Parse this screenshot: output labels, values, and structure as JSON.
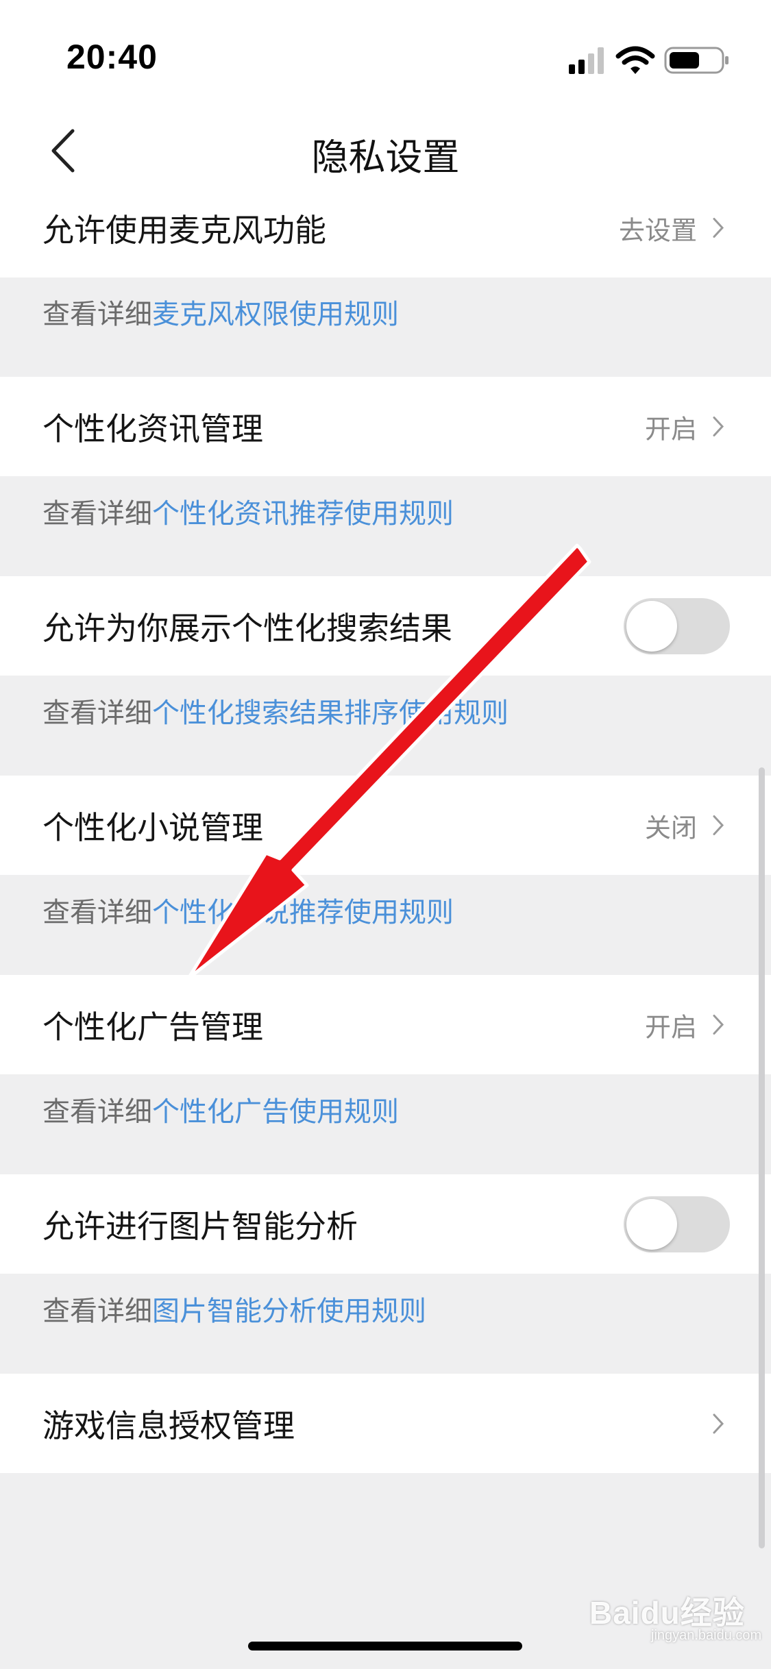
{
  "status_bar": {
    "time": "20:40"
  },
  "nav": {
    "title": "隐私设置"
  },
  "settings": [
    {
      "label": "允许使用麦克风功能",
      "value": "去设置",
      "note_prefix": "查看详细",
      "note_link": "麦克风权限使用规则"
    },
    {
      "label": "个性化资讯管理",
      "value": "开启",
      "note_prefix": "查看详细",
      "note_link": "个性化资讯推荐使用规则"
    },
    {
      "label": "允许为你展示个性化搜索结果",
      "toggle_on": false,
      "note_prefix": "查看详细",
      "note_link": "个性化搜索结果排序使用规则"
    },
    {
      "label": "个性化小说管理",
      "value": "关闭",
      "note_prefix": "查看详细",
      "note_link": "个性化小说推荐使用规则"
    },
    {
      "label": "个性化广告管理",
      "value": "开启",
      "note_prefix": "查看详细",
      "note_link": "个性化广告使用规则"
    },
    {
      "label": "允许进行图片智能分析",
      "toggle_on": false,
      "note_prefix": "查看详细",
      "note_link": "图片智能分析使用规则"
    },
    {
      "label": "游戏信息授权管理"
    }
  ],
  "watermark": {
    "brand": "Baidu经验",
    "url": "jingyan.baidu.com"
  },
  "colors": {
    "link": "#4a90d9",
    "annotation_arrow": "#e8141b",
    "background": "#efeff0"
  }
}
